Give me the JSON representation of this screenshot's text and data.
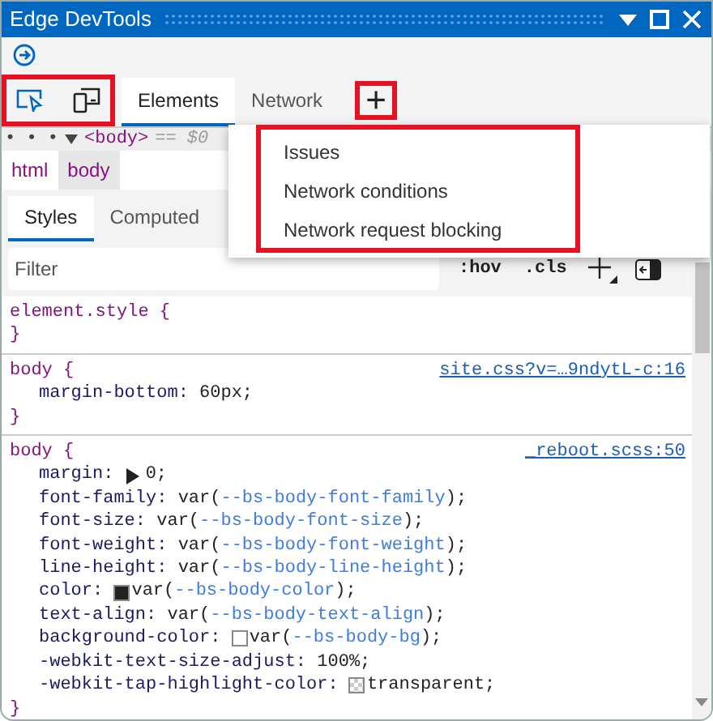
{
  "window": {
    "title": "Edge DevTools"
  },
  "tool_buttons": {
    "highlighted": true
  },
  "tabs": [
    {
      "label": "Elements",
      "selected": true
    },
    {
      "label": "Network",
      "selected": false
    }
  ],
  "add_tab": {
    "label": "+",
    "highlighted": true
  },
  "more_tools_menu": {
    "highlighted": true,
    "items": [
      "Issues",
      "Network conditions",
      "Network request blocking"
    ]
  },
  "dom_path": {
    "ellipsis": "• • •",
    "node": "<body>",
    "ref": "== $0"
  },
  "crumbs": [
    {
      "label": "html",
      "selected": false
    },
    {
      "label": "body",
      "selected": true
    }
  ],
  "subtabs": [
    {
      "label": "Styles",
      "selected": true
    },
    {
      "label": "Computed",
      "selected": false
    }
  ],
  "filter": {
    "placeholder": "Filter",
    "hov": ":hov",
    "cls": ".cls"
  },
  "rules": [
    {
      "selector": "element.style {",
      "close": "}"
    },
    {
      "selector": "body {",
      "source": "site.css?v=…9ndytL-c:16",
      "close": "}",
      "declarations": [
        {
          "property": "margin-bottom:",
          "kind": "plain",
          "parts": [
            {
              "text": "60px;",
              "kind": "plain"
            }
          ]
        }
      ]
    },
    {
      "selector": "body {",
      "source": "_reboot.scss:50",
      "close": "}",
      "declarations": [
        {
          "property": "margin:",
          "kind": "expandable",
          "parts": [
            {
              "text": "0;",
              "kind": "plain"
            }
          ]
        },
        {
          "property": "font-family:",
          "kind": "plain",
          "parts": [
            {
              "text": "var(",
              "kind": "plain"
            },
            {
              "text": "--bs-body-font-family",
              "kind": "var"
            },
            {
              "text": ");",
              "kind": "plain"
            }
          ]
        },
        {
          "property": "font-size:",
          "kind": "plain",
          "parts": [
            {
              "text": "var(",
              "kind": "plain"
            },
            {
              "text": "--bs-body-font-size",
              "kind": "var"
            },
            {
              "text": ");",
              "kind": "plain"
            }
          ]
        },
        {
          "property": "font-weight:",
          "kind": "plain",
          "parts": [
            {
              "text": "var(",
              "kind": "plain"
            },
            {
              "text": "--bs-body-font-weight",
              "kind": "var"
            },
            {
              "text": ");",
              "kind": "plain"
            }
          ]
        },
        {
          "property": "line-height:",
          "kind": "plain",
          "parts": [
            {
              "text": "var(",
              "kind": "plain"
            },
            {
              "text": "--bs-body-line-height",
              "kind": "var"
            },
            {
              "text": ");",
              "kind": "plain"
            }
          ]
        },
        {
          "property": "color:",
          "kind": "color",
          "color": "#222222",
          "parts": [
            {
              "text": "var(",
              "kind": "plain"
            },
            {
              "text": "--bs-body-color",
              "kind": "var"
            },
            {
              "text": ");",
              "kind": "plain"
            }
          ]
        },
        {
          "property": "text-align:",
          "kind": "plain",
          "parts": [
            {
              "text": "var(",
              "kind": "plain"
            },
            {
              "text": "--bs-body-text-align",
              "kind": "var"
            },
            {
              "text": ");",
              "kind": "plain"
            }
          ]
        },
        {
          "property": "background-color:",
          "kind": "color",
          "color": "#ffffff",
          "parts": [
            {
              "text": "var(",
              "kind": "plain"
            },
            {
              "text": "--bs-body-bg",
              "kind": "var"
            },
            {
              "text": ");",
              "kind": "plain"
            }
          ]
        },
        {
          "property": "-webkit-text-size-adjust:",
          "kind": "plain",
          "parts": [
            {
              "text": "100%;",
              "kind": "plain"
            }
          ]
        },
        {
          "property": "-webkit-tap-highlight-color:",
          "kind": "transparent",
          "parts": [
            {
              "text": "transparent;",
              "kind": "plain"
            }
          ]
        }
      ]
    }
  ]
}
